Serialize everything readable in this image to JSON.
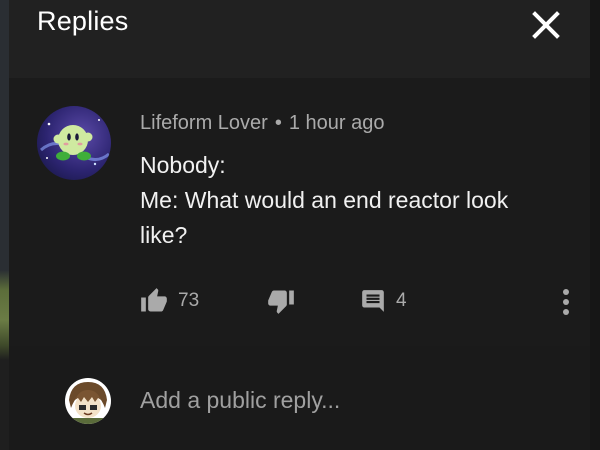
{
  "header": {
    "title": "Replies",
    "close_icon": "close-icon"
  },
  "comment": {
    "author": "Lifeform Lover",
    "separator": "•",
    "time": "1 hour ago",
    "text_lines": [
      "Nobody:",
      "Me: What would an end reactor look",
      "like?"
    ],
    "likes": "73",
    "replies": "4",
    "icons": [
      "thumb-up-icon",
      "thumb-down-icon",
      "reply-icon",
      "more-vert-icon"
    ]
  },
  "reply_box": {
    "placeholder": "Add a public reply..."
  },
  "colors": {
    "background": "#181818",
    "header": "#212121",
    "text": "#f1f1f1",
    "muted": "#aaaaaa"
  }
}
